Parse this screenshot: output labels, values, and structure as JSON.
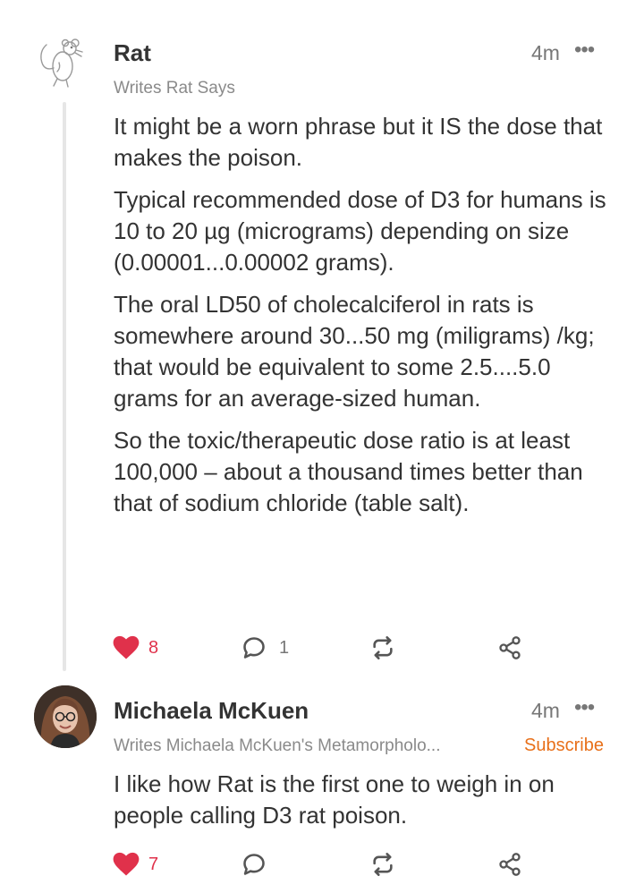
{
  "comments": [
    {
      "author": "Rat",
      "time": "4m",
      "byline": "Writes Rat Says",
      "paragraphs": [
        "It might be a worn phrase but it IS the dose that makes the poison.",
        "Typical recommended dose of D3 for humans is 10 to 20 µg (micrograms) depending on size (0.00001...0.00002 grams).",
        "The oral LD50 of cholecalciferol in rats is somewhere around 30...50 mg (miligrams) /kg; that would be equivalent to some 2.5....5.0 grams for an average-sized human.",
        "So the toxic/therapeutic dose ratio is at least 100,000 – about a thousand times better than that of sodium chloride (table salt)."
      ],
      "likes": "8",
      "replies": "1",
      "more_label": "•••"
    },
    {
      "author": "Michaela McKuen",
      "time": "4m",
      "byline": "Writes Michaela McKuen's Metamorpholo...",
      "subscribe_label": "Subscribe",
      "paragraphs": [
        "I like how Rat is the first one to weigh in on people calling D3 rat poison."
      ],
      "likes": "7",
      "more_label": "•••"
    }
  ],
  "colors": {
    "like": "#e0314b",
    "subscribe": "#e8701a",
    "text": "#333333",
    "muted": "#777777"
  },
  "icons": [
    "rat-avatar-icon",
    "heart-icon",
    "comment-bubble-icon",
    "restack-icon",
    "share-icon",
    "more-icon"
  ]
}
